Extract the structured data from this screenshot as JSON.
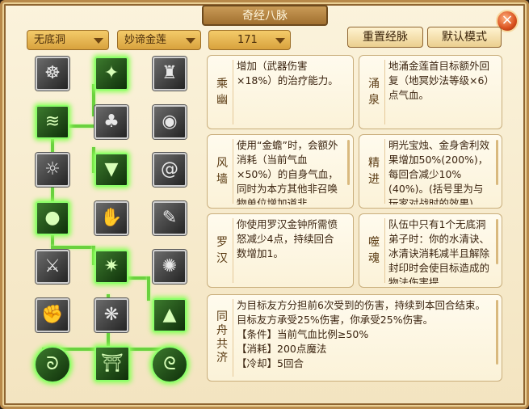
{
  "window": {
    "title": "奇经八脉",
    "close_label": "×"
  },
  "filters": {
    "sect": "无底洞",
    "school": "妙谛金莲",
    "points": "171"
  },
  "toolbar": {
    "reset_label": "重置经脉",
    "default_label": "默认模式"
  },
  "skills": [
    {
      "name": "乘幽",
      "desc": "增加（武器伤害×18%）的治疗能力。"
    },
    {
      "name": "涌泉",
      "desc": "地涌金莲首目标额外回复（地冥妙法等级×6）点气血。"
    },
    {
      "name": "风墙",
      "desc": "使用“金蟾”时，会额外消耗（当前气血×50%）的自身气血，同时为本方其他非召唤物单位增加道非"
    },
    {
      "name": "精进",
      "desc": "明光宝烛、金身舍利效果增加50%(200%)，每回合减少10%(40%)。(括号里为与玩家对战时的效果)"
    },
    {
      "name": "罗汉",
      "desc": "你使用罗汉金钟所需愤怒减少4点，持续回合数增加1。"
    },
    {
      "name": "噬魂",
      "desc": "队伍中只有1个无底洞弟子时：你的水清诀、冰清诀消耗减半且解除封印时会使目标造成的物法伤害提"
    },
    {
      "name": "同舟共济",
      "lines": [
        "为目标友方分担前6次受到的伤害，持续到本回合结束。",
        "目标友方承受25%伤害，你承受25%伤害。",
        "【条件】当前气血比例≥50%",
        "【消耗】200点魔法",
        "【冷却】5回合"
      ]
    }
  ],
  "tree_icons": [
    "meditate-icon",
    "arrows-icon",
    "figures-icon",
    "wave-icon",
    "stump-icon",
    "signal-icon",
    "sun-icon",
    "whirlwind-icon",
    "swirl-icon",
    "orb-icon",
    "claw-icon",
    "scroll-icon",
    "blade-icon",
    "thorn-icon",
    "burst-icon",
    "fist-icon",
    "splash-icon",
    "bell-icon",
    "spiral-left-icon",
    "gate-icon",
    "spiral-right-icon"
  ]
}
